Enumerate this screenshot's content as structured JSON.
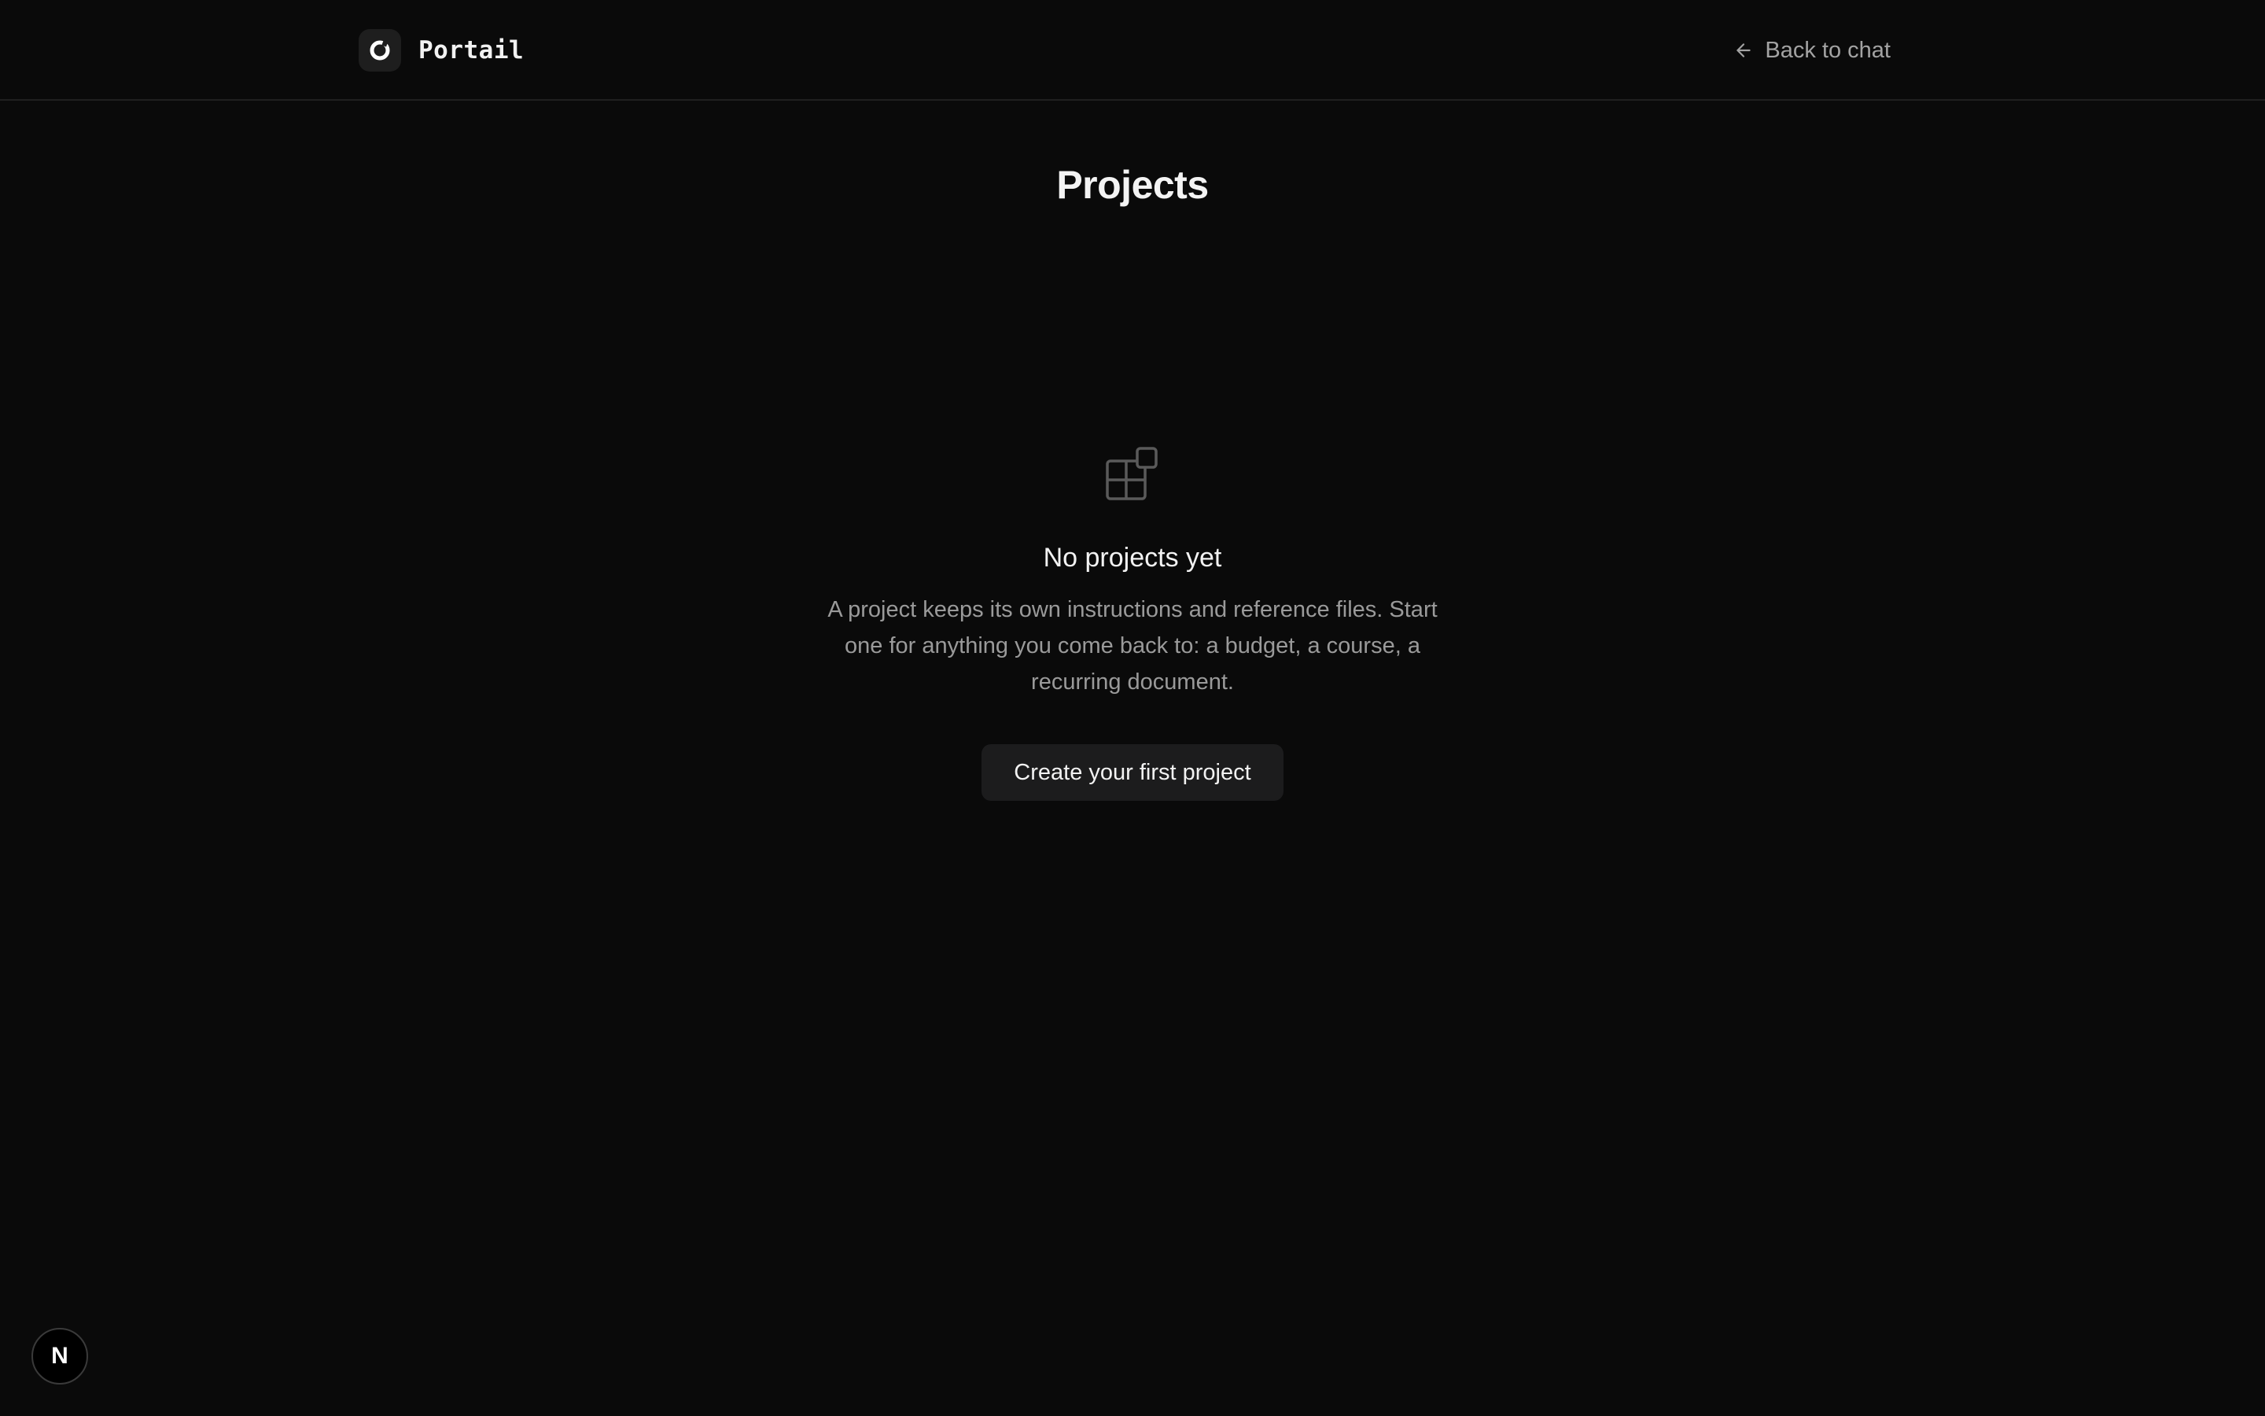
{
  "header": {
    "brand_name": "Portail",
    "logo_icon": "portail-logo-icon",
    "back_link": {
      "label": "Back to chat",
      "icon": "arrow-left-icon"
    }
  },
  "main": {
    "title": "Projects",
    "empty_state": {
      "icon": "layout-blocks-icon",
      "title": "No projects yet",
      "description": "A project keeps its own instructions and reference files. Start one for anything you come back to: a budget, a course, a recurring document.",
      "cta_label": "Create your first project"
    }
  },
  "dev_badge": {
    "label": "N"
  },
  "colors": {
    "background": "#0a0a0a",
    "button_background": "#1c1c1d",
    "muted_text": "#9a9a9a",
    "divider": "#202020"
  }
}
